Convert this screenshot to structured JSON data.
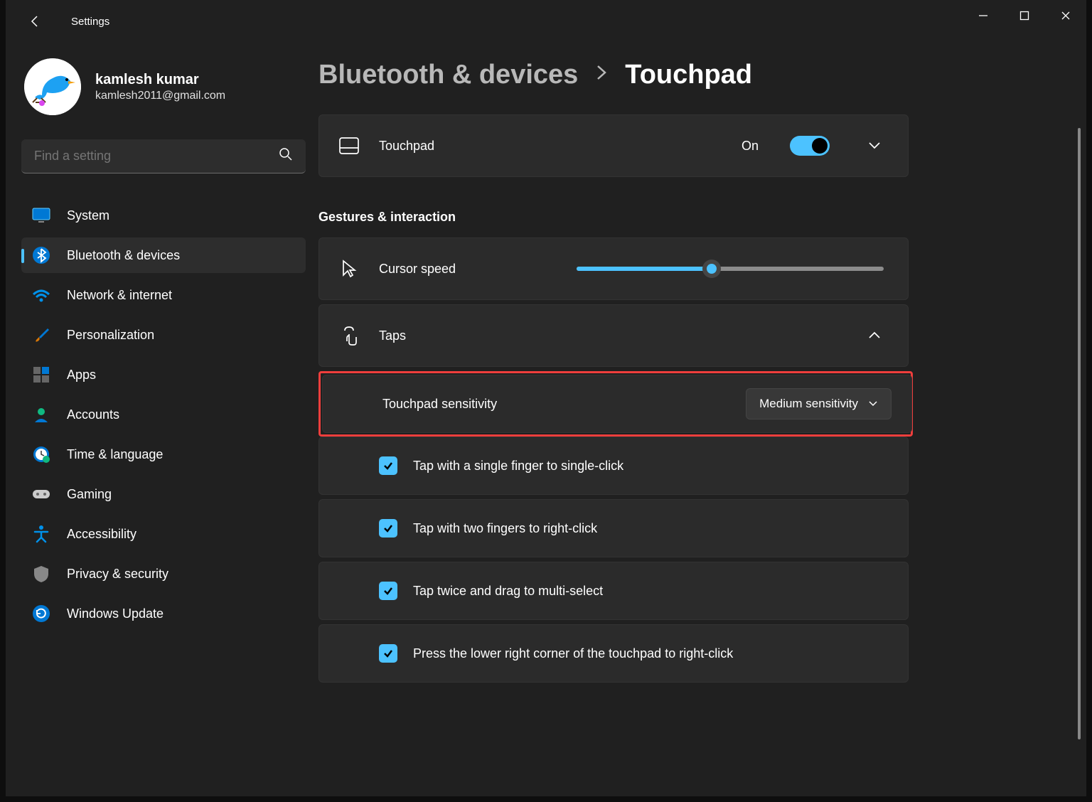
{
  "window": {
    "title": "Settings"
  },
  "profile": {
    "name": "kamlesh kumar",
    "email": "kamlesh2011@gmail.com"
  },
  "search": {
    "placeholder": "Find a setting"
  },
  "nav": {
    "items": [
      {
        "label": "System"
      },
      {
        "label": "Bluetooth & devices"
      },
      {
        "label": "Network & internet"
      },
      {
        "label": "Personalization"
      },
      {
        "label": "Apps"
      },
      {
        "label": "Accounts"
      },
      {
        "label": "Time & language"
      },
      {
        "label": "Gaming"
      },
      {
        "label": "Accessibility"
      },
      {
        "label": "Privacy & security"
      },
      {
        "label": "Windows Update"
      }
    ]
  },
  "breadcrumb": {
    "parent": "Bluetooth & devices",
    "current": "Touchpad"
  },
  "touchpad": {
    "label": "Touchpad",
    "state": "On"
  },
  "sections": {
    "gestures": "Gestures & interaction"
  },
  "cursor": {
    "label": "Cursor speed"
  },
  "taps": {
    "label": "Taps",
    "sensitivity": {
      "label": "Touchpad sensitivity",
      "value": "Medium sensitivity"
    },
    "options": [
      "Tap with a single finger to single-click",
      "Tap with two fingers to right-click",
      "Tap twice and drag to multi-select",
      "Press the lower right corner of the touchpad to right-click"
    ]
  }
}
